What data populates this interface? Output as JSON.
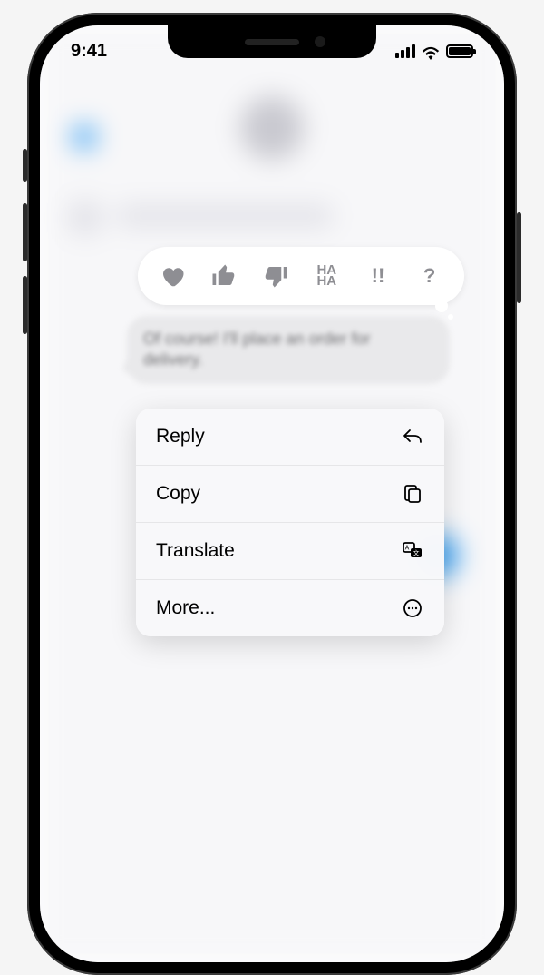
{
  "status": {
    "time": "9:41"
  },
  "tapbacks": {
    "haha": "HA\nHA",
    "emphasis": "!!",
    "question": "?"
  },
  "message": {
    "text": "Of course! I'll place an order for delivery."
  },
  "menu": {
    "reply": "Reply",
    "copy": "Copy",
    "translate": "Translate",
    "more": "More..."
  }
}
